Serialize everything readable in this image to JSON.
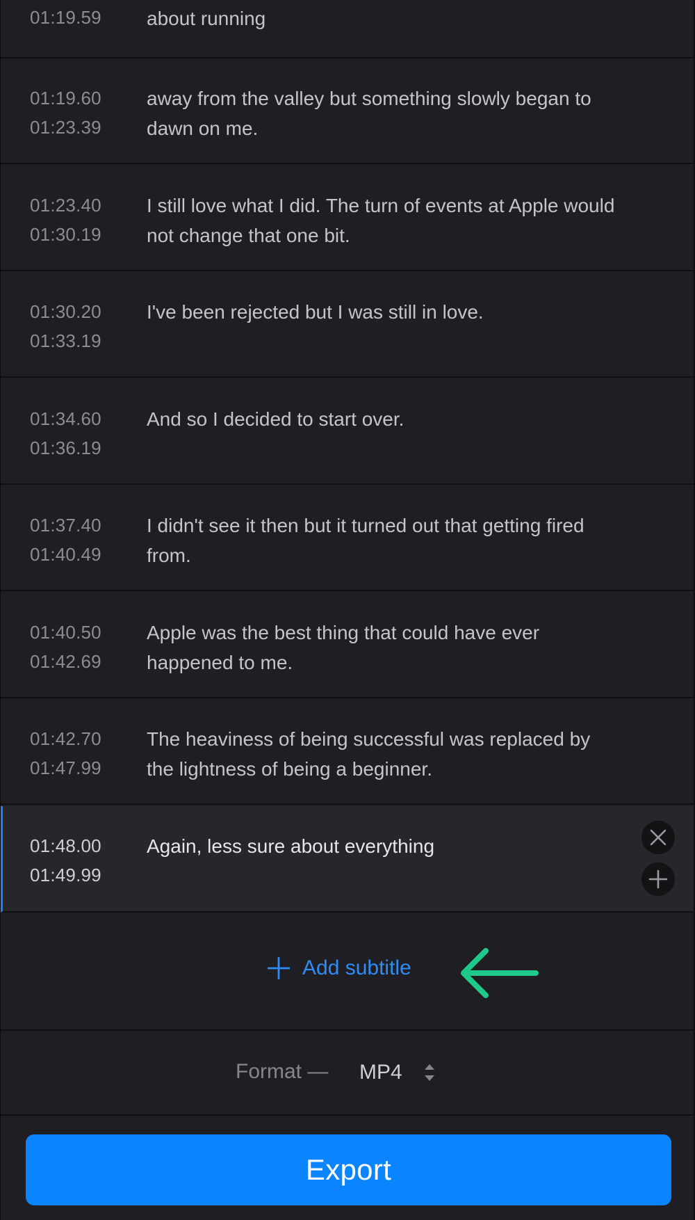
{
  "subtitles": [
    {
      "start": "01:19.59",
      "end": "",
      "text": "about running"
    },
    {
      "start": "01:19.60",
      "end": "01:23.39",
      "text": "away from the valley but something slowly began to dawn on me."
    },
    {
      "start": "01:23.40",
      "end": "01:30.19",
      "text": "I still love what I did. The turn of events at Apple would not change that one bit."
    },
    {
      "start": "01:30.20",
      "end": "01:33.19",
      "text": "I've been rejected but I was still in love."
    },
    {
      "start": "01:34.60",
      "end": "01:36.19",
      "text": "And so I decided to start over."
    },
    {
      "start": "01:37.40",
      "end": "01:40.49",
      "text": "I didn't see it then but it turned out that getting fired from."
    },
    {
      "start": "01:40.50",
      "end": "01:42.69",
      "text": "Apple was the best thing that could have ever happened to me."
    },
    {
      "start": "01:42.70",
      "end": "01:47.99",
      "text": "The heaviness of being successful was replaced by the lightness of being a beginner."
    },
    {
      "start": "01:48.00",
      "end": "01:49.99",
      "text": "Again, less sure about everything"
    }
  ],
  "active_row": {
    "delete_icon": "close-icon",
    "insert_icon": "plus-icon"
  },
  "add_subtitle": {
    "label": "Add subtitle",
    "icon": "plus-icon"
  },
  "annotation": {
    "icon": "arrow-left-icon",
    "color": "#1ec98a"
  },
  "format": {
    "label": "Format —",
    "value": "MP4",
    "icon": "chevron-updown-icon"
  },
  "export": {
    "label": "Export",
    "color": "#0a84ff"
  },
  "colors": {
    "background": "#1f1f23",
    "accent": "#2f8cf5"
  }
}
